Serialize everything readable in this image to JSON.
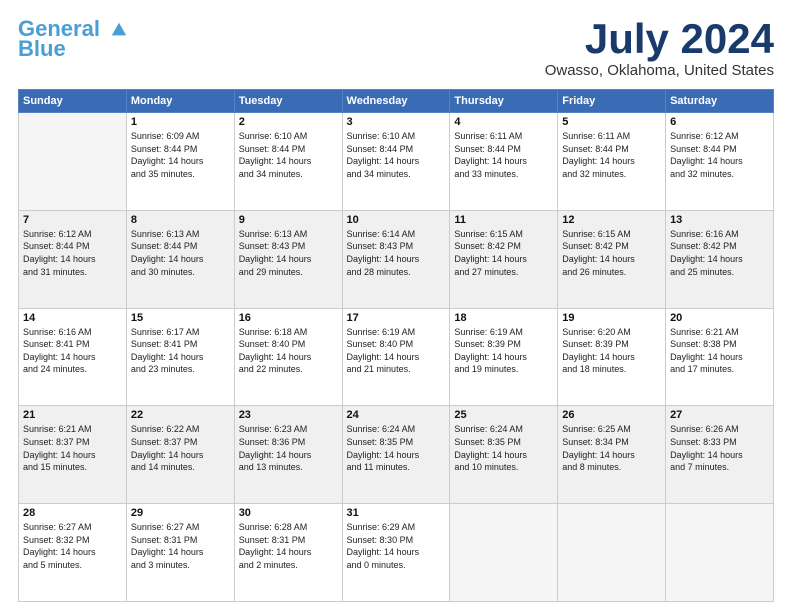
{
  "logo": {
    "line1": "General",
    "line2": "Blue"
  },
  "title": "July 2024",
  "location": "Owasso, Oklahoma, United States",
  "days_of_week": [
    "Sunday",
    "Monday",
    "Tuesday",
    "Wednesday",
    "Thursday",
    "Friday",
    "Saturday"
  ],
  "weeks": [
    [
      {
        "day": "",
        "info": ""
      },
      {
        "day": "1",
        "info": "Sunrise: 6:09 AM\nSunset: 8:44 PM\nDaylight: 14 hours\nand 35 minutes."
      },
      {
        "day": "2",
        "info": "Sunrise: 6:10 AM\nSunset: 8:44 PM\nDaylight: 14 hours\nand 34 minutes."
      },
      {
        "day": "3",
        "info": "Sunrise: 6:10 AM\nSunset: 8:44 PM\nDaylight: 14 hours\nand 34 minutes."
      },
      {
        "day": "4",
        "info": "Sunrise: 6:11 AM\nSunset: 8:44 PM\nDaylight: 14 hours\nand 33 minutes."
      },
      {
        "day": "5",
        "info": "Sunrise: 6:11 AM\nSunset: 8:44 PM\nDaylight: 14 hours\nand 32 minutes."
      },
      {
        "day": "6",
        "info": "Sunrise: 6:12 AM\nSunset: 8:44 PM\nDaylight: 14 hours\nand 32 minutes."
      }
    ],
    [
      {
        "day": "7",
        "info": "Sunrise: 6:12 AM\nSunset: 8:44 PM\nDaylight: 14 hours\nand 31 minutes."
      },
      {
        "day": "8",
        "info": "Sunrise: 6:13 AM\nSunset: 8:44 PM\nDaylight: 14 hours\nand 30 minutes."
      },
      {
        "day": "9",
        "info": "Sunrise: 6:13 AM\nSunset: 8:43 PM\nDaylight: 14 hours\nand 29 minutes."
      },
      {
        "day": "10",
        "info": "Sunrise: 6:14 AM\nSunset: 8:43 PM\nDaylight: 14 hours\nand 28 minutes."
      },
      {
        "day": "11",
        "info": "Sunrise: 6:15 AM\nSunset: 8:42 PM\nDaylight: 14 hours\nand 27 minutes."
      },
      {
        "day": "12",
        "info": "Sunrise: 6:15 AM\nSunset: 8:42 PM\nDaylight: 14 hours\nand 26 minutes."
      },
      {
        "day": "13",
        "info": "Sunrise: 6:16 AM\nSunset: 8:42 PM\nDaylight: 14 hours\nand 25 minutes."
      }
    ],
    [
      {
        "day": "14",
        "info": "Sunrise: 6:16 AM\nSunset: 8:41 PM\nDaylight: 14 hours\nand 24 minutes."
      },
      {
        "day": "15",
        "info": "Sunrise: 6:17 AM\nSunset: 8:41 PM\nDaylight: 14 hours\nand 23 minutes."
      },
      {
        "day": "16",
        "info": "Sunrise: 6:18 AM\nSunset: 8:40 PM\nDaylight: 14 hours\nand 22 minutes."
      },
      {
        "day": "17",
        "info": "Sunrise: 6:19 AM\nSunset: 8:40 PM\nDaylight: 14 hours\nand 21 minutes."
      },
      {
        "day": "18",
        "info": "Sunrise: 6:19 AM\nSunset: 8:39 PM\nDaylight: 14 hours\nand 19 minutes."
      },
      {
        "day": "19",
        "info": "Sunrise: 6:20 AM\nSunset: 8:39 PM\nDaylight: 14 hours\nand 18 minutes."
      },
      {
        "day": "20",
        "info": "Sunrise: 6:21 AM\nSunset: 8:38 PM\nDaylight: 14 hours\nand 17 minutes."
      }
    ],
    [
      {
        "day": "21",
        "info": "Sunrise: 6:21 AM\nSunset: 8:37 PM\nDaylight: 14 hours\nand 15 minutes."
      },
      {
        "day": "22",
        "info": "Sunrise: 6:22 AM\nSunset: 8:37 PM\nDaylight: 14 hours\nand 14 minutes."
      },
      {
        "day": "23",
        "info": "Sunrise: 6:23 AM\nSunset: 8:36 PM\nDaylight: 14 hours\nand 13 minutes."
      },
      {
        "day": "24",
        "info": "Sunrise: 6:24 AM\nSunset: 8:35 PM\nDaylight: 14 hours\nand 11 minutes."
      },
      {
        "day": "25",
        "info": "Sunrise: 6:24 AM\nSunset: 8:35 PM\nDaylight: 14 hours\nand 10 minutes."
      },
      {
        "day": "26",
        "info": "Sunrise: 6:25 AM\nSunset: 8:34 PM\nDaylight: 14 hours\nand 8 minutes."
      },
      {
        "day": "27",
        "info": "Sunrise: 6:26 AM\nSunset: 8:33 PM\nDaylight: 14 hours\nand 7 minutes."
      }
    ],
    [
      {
        "day": "28",
        "info": "Sunrise: 6:27 AM\nSunset: 8:32 PM\nDaylight: 14 hours\nand 5 minutes."
      },
      {
        "day": "29",
        "info": "Sunrise: 6:27 AM\nSunset: 8:31 PM\nDaylight: 14 hours\nand 3 minutes."
      },
      {
        "day": "30",
        "info": "Sunrise: 6:28 AM\nSunset: 8:31 PM\nDaylight: 14 hours\nand 2 minutes."
      },
      {
        "day": "31",
        "info": "Sunrise: 6:29 AM\nSunset: 8:30 PM\nDaylight: 14 hours\nand 0 minutes."
      },
      {
        "day": "",
        "info": ""
      },
      {
        "day": "",
        "info": ""
      },
      {
        "day": "",
        "info": ""
      }
    ]
  ]
}
